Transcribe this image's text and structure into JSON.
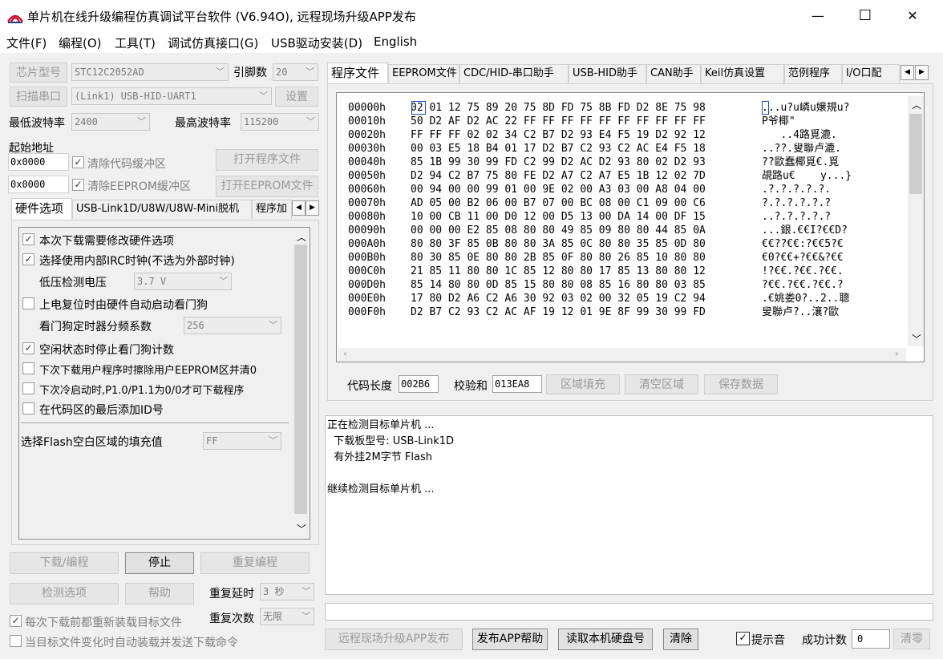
{
  "window": {
    "title": "单片机在线升级编程仿真调试平台软件 (V6.94O), 远程现场升级APP发布",
    "minimize": "—",
    "maximize": "☐",
    "close": "✕"
  },
  "menu": [
    "文件(F)",
    "编程(O)",
    "工具(T)",
    "调试仿真接口(G)",
    "USB驱动安装(D)",
    "English"
  ],
  "left": {
    "chip_btn": "芯片型号",
    "chip_value": "STC12C2052AD",
    "pin_label": "引脚数",
    "pin_value": "20",
    "scan_btn": "扫描串口",
    "port_value": "(Link1) USB-HID-UART1",
    "settings_btn": "设置",
    "min_baud_label": "最低波特率",
    "min_baud_value": "2400",
    "max_baud_label": "最高波特率",
    "max_baud_value": "115200",
    "start_addr_label": "起始地址",
    "addr1": "0x0000",
    "clear_code_label": "清除代码缓冲区",
    "open_prog_btn": "打开程序文件",
    "addr2": "0x0000",
    "clear_eeprom_label": "清除EEPROM缓冲区",
    "open_eeprom_btn": "打开EEPROM文件",
    "tabs": [
      "硬件选项",
      "USB-Link1D/U8W/U8W-Mini脱机",
      "程序加"
    ],
    "hw_options": {
      "opt1": "本次下载需要修改硬件选项",
      "opt2": "选择使用内部IRC时钟(不选为外部时钟)",
      "lvd_label": "低压检测电压",
      "lvd_value": "3.7 V",
      "opt3": "上电复位时由硬件自动启动看门狗",
      "wdt_label": "看门狗定时器分频系数",
      "wdt_value": "256",
      "opt4": "空闲状态时停止看门狗计数",
      "opt5": "下次下载用户程序时擦除用户EEPROM区并清0",
      "opt6": "下次冷启动时,P1.0/P1.1为0/0才可下载程序",
      "opt7": "在代码区的最后添加ID号",
      "fill_label": "选择Flash空白区域的填充值",
      "fill_value": "FF"
    },
    "download_btn": "下载/编程",
    "stop_btn": "停止",
    "reprog_btn": "重复编程",
    "detect_btn": "检测选项",
    "help_btn": "帮助",
    "delay_label": "重复延时",
    "delay_value": "3 秒",
    "count_label": "重复次数",
    "count_value": "无限",
    "reload_label": "每次下载前都重新装载目标文件",
    "auto_label": "当目标文件变化时自动装载并发送下载命令"
  },
  "right": {
    "tabs": [
      "程序文件",
      "EEPROM文件",
      "CDC/HID-串口助手",
      "USB-HID助手",
      "CAN助手",
      "Keil仿真设置",
      "范例程序",
      "I/O口配"
    ],
    "hex_rows": [
      {
        "addr": "00000h",
        "bytes": "02 01 12 75 89 20 75 8D FD 75 8B FD D2 8E 75 98",
        "ascii": "...u?u嶙u嬢規u?"
      },
      {
        "addr": "00010h",
        "bytes": "50 D2 AF D2 AC 22 FF FF FF FF FF FF FF FF FF FF",
        "ascii": "P爷椰\""
      },
      {
        "addr": "00020h",
        "bytes": "FF FF FF 02 02 34 C2 B7 D2 93 E4 F5 19 D2 92 12",
        "ascii": "   ..4路覓漉."
      },
      {
        "addr": "00030h",
        "bytes": "00 03 E5 18 B4 01 17 D2 B7 C2 93 C2 AC E4 F5 18",
        "ascii": "..??.叟聯卢漉."
      },
      {
        "addr": "00040h",
        "bytes": "85 1B 99 30 99 FD C2 99 D2 AC D2 93 80 02 D2 93",
        "ascii": "??歐蠢椰覓€.覓"
      },
      {
        "addr": "00050h",
        "bytes": "D2 94 C2 B7 75 80 FE D2 A7 C2 A7 E5 1B 12 02 7D",
        "ascii": "覘路u€    y...}"
      },
      {
        "addr": "00060h",
        "bytes": "00 94 00 00 99 01 00 9E 02 00 A3 03 00 A8 04 00",
        "ascii": ".?.?.?.?.?."
      },
      {
        "addr": "00070h",
        "bytes": "AD 05 00 B2 06 00 B7 07 00 BC 08 00 C1 09 00 C6",
        "ascii": "?.?.?.?.?.?"
      },
      {
        "addr": "00080h",
        "bytes": "10 00 CB 11 00 D0 12 00 D5 13 00 DA 14 00 DF 15",
        "ascii": "..?.?.?.?.?"
      },
      {
        "addr": "00090h",
        "bytes": "00 00 00 E2 85 08 80 80 49 85 09 80 80 44 85 0A",
        "ascii": "...銀.€€I?€€D?"
      },
      {
        "addr": "000A0h",
        "bytes": "80 80 3F 85 0B 80 80 3A 85 0C 80 80 35 85 0D 80",
        "ascii": "€€??€€:?€€5?€"
      },
      {
        "addr": "000B0h",
        "bytes": "80 30 85 0E 80 80 2B 85 0F 80 80 26 85 10 80 80",
        "ascii": "€0?€€+?€€&?€€"
      },
      {
        "addr": "000C0h",
        "bytes": "21 85 11 80 80 1C 85 12 80 80 17 85 13 80 80 12",
        "ascii": "!?€€.?€€.?€€."
      },
      {
        "addr": "000D0h",
        "bytes": "85 14 80 80 0D 85 15 80 80 08 85 16 80 80 03 85",
        "ascii": "?€€.?€€.?€€.?"
      },
      {
        "addr": "000E0h",
        "bytes": "17 80 D2 A6 C2 A6 30 92 03 02 00 32 05 19 C2 94",
        "ascii": ".€姚娄0?..2..聰"
      },
      {
        "addr": "000F0h",
        "bytes": "D2 B7 C2 93 C2 AC AF 19 12 01 9E 8F 99 30 99 FD",
        "ascii": "叟聯卢?..瀼?歐"
      }
    ],
    "code_len_label": "代码长度",
    "code_len_value": "002B6",
    "checksum_label": "校验和",
    "checksum_value": "013EA8",
    "fill_btn": "区域填充",
    "clear_btn": "清空区域",
    "save_btn": "保存数据",
    "log": [
      "正在检测目标单片机 ...",
      "  下载板型号: USB-Link1D",
      "  有外挂2M字节 Flash",
      "",
      "继续检测目标单片机 ..."
    ],
    "remote_btn": "远程现场升级APP发布",
    "publish_help_btn": "发布APP帮助",
    "read_disk_btn": "读取本机硬盘号",
    "clear_log_btn": "清除",
    "beep_label": "提示音",
    "success_label": "成功计数",
    "success_value": "0",
    "reset_btn": "清零"
  }
}
